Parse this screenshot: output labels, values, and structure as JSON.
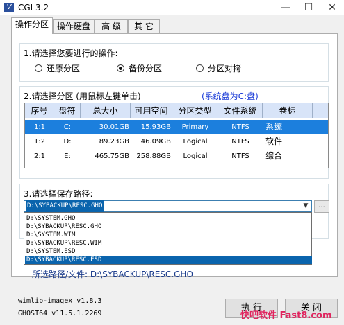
{
  "window": {
    "title": "CGI 3.2",
    "minimize": "—",
    "maximize": "☐",
    "close": "✕"
  },
  "tabs": [
    "操作分区",
    "操作硬盘",
    "高 级",
    "其 它"
  ],
  "operation": {
    "label": "1.请选择您要进行的操作:",
    "options": [
      "还原分区",
      "备份分区",
      "分区对拷"
    ],
    "selected_index": 1
  },
  "partition": {
    "label": "2.请选择分区 (用鼠标左键单击)",
    "system_note": "(系统盘为C:盘)",
    "columns": [
      "序号",
      "盘符",
      "总大小",
      "可用空间",
      "分区类型",
      "文件系统",
      "卷标"
    ],
    "rows": [
      [
        "1:1",
        "C:",
        "30.01GB",
        "15.93GB",
        "Primary",
        "NTFS",
        "系统"
      ],
      [
        "1:2",
        "D:",
        "89.23GB",
        "46.09GB",
        "Logical",
        "NTFS",
        "软件"
      ],
      [
        "2:1",
        "E:",
        "465.75GB",
        "258.88GB",
        "Logical",
        "NTFS",
        "综合"
      ]
    ],
    "selected_row": 0
  },
  "save_path": {
    "label": "3.请选择保存路径:",
    "current": "D:\\SYBACKUP\\RESC.GHO",
    "browse": "...",
    "options": [
      "D:\\SYSTEM.GHO",
      "D:\\SYBACKUP\\RESC.GHO",
      "D:\\SYSTEM.WIM",
      "D:\\SYBACKUP\\RESC.WIM",
      "D:\\SYSTEM.ESD",
      "D:\\SYBACKUP\\RESC.ESD"
    ],
    "highlighted_index": 5,
    "selected_label": "所选路径/文件: D:\\SYBACKUP\\RESC.GHO"
  },
  "footer": {
    "wimlib": "wimlib-imagex v1.8.3",
    "ghost": "GHOST64 v11.5.1.2269",
    "execute": "执 行",
    "close": "关 闭"
  },
  "watermark": "快吧软件 Fast8.com",
  "colors": {
    "selection": "#1c7fdd",
    "system_note": "#1b3cd8",
    "path_label": "#1b3c8c",
    "watermark": "#e0245e"
  }
}
